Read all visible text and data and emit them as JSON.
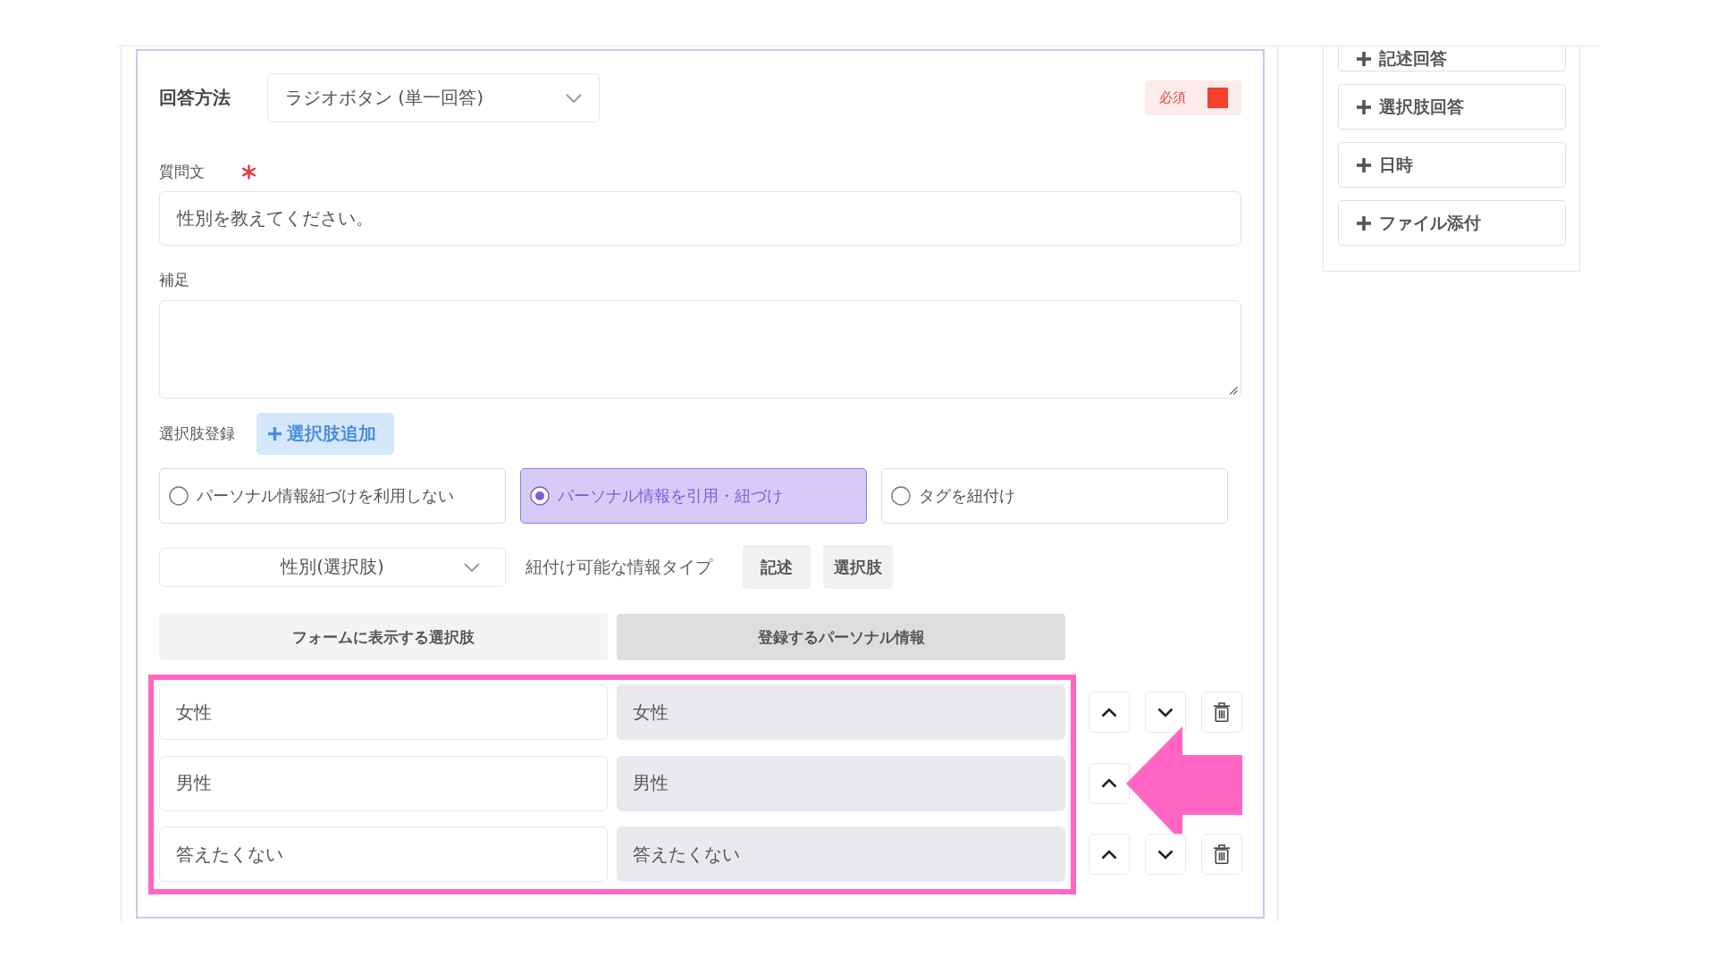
{
  "answer_method": {
    "label": "回答方法",
    "value": "ラジオボタン (単一回答)"
  },
  "required_toggle": {
    "label": "必須",
    "checked": true
  },
  "question": {
    "label": "質問文",
    "required": true,
    "value": "性別を教えてください。"
  },
  "supplement": {
    "label": "補足"
  },
  "choice_registration": {
    "label": "選択肢登録",
    "add_button": "選択肢追加"
  },
  "link_modes": [
    {
      "label": "パーソナル情報紐づけを利用しない",
      "selected": false
    },
    {
      "label": "パーソナル情報を引用・紐づけ",
      "selected": true
    },
    {
      "label": "タグを紐付け",
      "selected": false
    }
  ],
  "personal_info_select": {
    "value": "性別(選択肢)"
  },
  "linkable_types": {
    "label": "紐付け可能な情報タイプ",
    "tags": [
      "記述",
      "選択肢"
    ]
  },
  "choices": {
    "highlighted": true,
    "columns": [
      {
        "label": "フォームに表示する選択肢",
        "kind": "editable"
      },
      {
        "label": "登録するパーソナル情報",
        "kind": "linked"
      }
    ],
    "rows": [
      {
        "cells": [
          "女性",
          "女性"
        ],
        "actions": [
          {
            "kind": "up"
          },
          {
            "kind": "down"
          },
          {
            "kind": "delete"
          }
        ],
        "pointed": false
      },
      {
        "cells": [
          "男性",
          "男性"
        ],
        "actions": [
          {
            "kind": "up"
          }
        ],
        "pointed": true
      },
      {
        "cells": [
          "答えたくない",
          "答えたくない"
        ],
        "actions": [
          {
            "kind": "up"
          },
          {
            "kind": "down"
          },
          {
            "kind": "delete"
          }
        ],
        "pointed": false
      }
    ]
  },
  "sidebar": {
    "items": [
      "記述回答",
      "選択肢回答",
      "日時",
      "ファイル添付"
    ]
  }
}
